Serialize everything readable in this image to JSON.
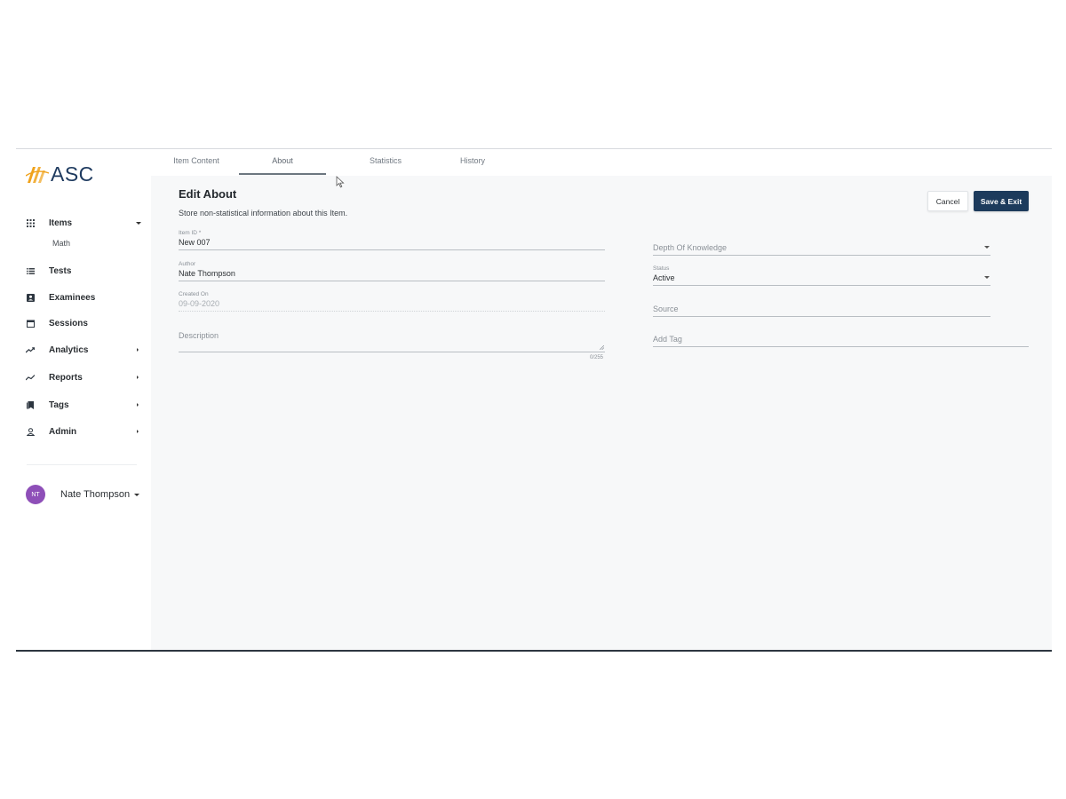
{
  "brand": {
    "name": "ASC",
    "accent": "#f0a21b",
    "primary": "#1d3b5c"
  },
  "sidebar": {
    "items": [
      {
        "label": "Items",
        "icon": "grid-icon",
        "caret": "down"
      },
      {
        "label": "Tests",
        "icon": "list-icon",
        "caret": "none"
      },
      {
        "label": "Examinees",
        "icon": "person-badge-icon",
        "caret": "none"
      },
      {
        "label": "Sessions",
        "icon": "calendar-icon",
        "caret": "none"
      },
      {
        "label": "Analytics",
        "icon": "trending-up-icon",
        "caret": "right"
      },
      {
        "label": "Reports",
        "icon": "chart-line-icon",
        "caret": "right"
      },
      {
        "label": "Tags",
        "icon": "tag-icon",
        "caret": "right"
      },
      {
        "label": "Admin",
        "icon": "user-icon",
        "caret": "right"
      }
    ],
    "subitems": {
      "items": [
        "Math"
      ]
    },
    "user": {
      "initials": "NT",
      "name": "Nate Thompson"
    }
  },
  "tabs": [
    {
      "label": "Item Content",
      "active": false
    },
    {
      "label": "About",
      "active": true
    },
    {
      "label": "Statistics",
      "active": false
    },
    {
      "label": "History",
      "active": false
    }
  ],
  "page": {
    "title": "Edit About",
    "subtitle": "Store non-statistical information about this Item.",
    "cancel_label": "Cancel",
    "save_label": "Save & Exit"
  },
  "form": {
    "item_id": {
      "label": "Item ID *",
      "value": "New 007"
    },
    "author": {
      "label": "Author",
      "value": "Nate Thompson"
    },
    "created_on": {
      "label": "Created On",
      "value": "09-09-2020"
    },
    "description": {
      "placeholder": "Description",
      "counter": "0/255"
    },
    "depth_of_knowledge": {
      "placeholder": "Depth Of Knowledge"
    },
    "status": {
      "label": "Status",
      "value": "Active"
    },
    "source": {
      "placeholder": "Source"
    },
    "add_tag": {
      "placeholder": "Add Tag"
    }
  }
}
